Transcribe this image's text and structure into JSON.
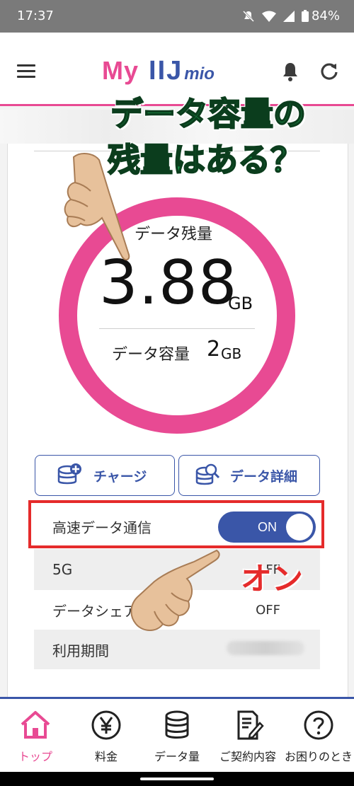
{
  "status": {
    "time": "17:37",
    "battery": "84%"
  },
  "header": {
    "logo_my": "My",
    "logo_iij": "IIJ",
    "logo_mio": "mio"
  },
  "overlay": {
    "line1": "データ容量の",
    "line2": "残量はある？"
  },
  "usage": {
    "remaining_label": "データ残量",
    "remaining_value": "3.88",
    "remaining_unit": "GB",
    "capacity_label": "データ容量",
    "capacity_value": "2",
    "capacity_unit": "GB",
    "ring_color": "#e84a93"
  },
  "actions": {
    "charge_label": "チャージ",
    "detail_label": "データ詳細"
  },
  "settings": {
    "highspeed_label": "高速データ通信",
    "highspeed_state": "ON",
    "rows": [
      {
        "label": "5G",
        "value": "FF"
      },
      {
        "label": "データシェア",
        "value": "OFF"
      },
      {
        "label": "利用期間",
        "value": ""
      }
    ]
  },
  "annotation": {
    "on_text": "オン"
  },
  "nav": [
    {
      "label": "トップ",
      "icon": "home-icon"
    },
    {
      "label": "料金",
      "icon": "yen-icon"
    },
    {
      "label": "データ量",
      "icon": "database-icon"
    },
    {
      "label": "ご契約内容",
      "icon": "contract-icon"
    },
    {
      "label": "お困りのとき",
      "icon": "help-icon"
    }
  ],
  "colors": {
    "brand_pink": "#e84a93",
    "brand_blue": "#3a56a8",
    "overlay_green": "#1a9b4e",
    "annot_red": "#e52b2b"
  }
}
